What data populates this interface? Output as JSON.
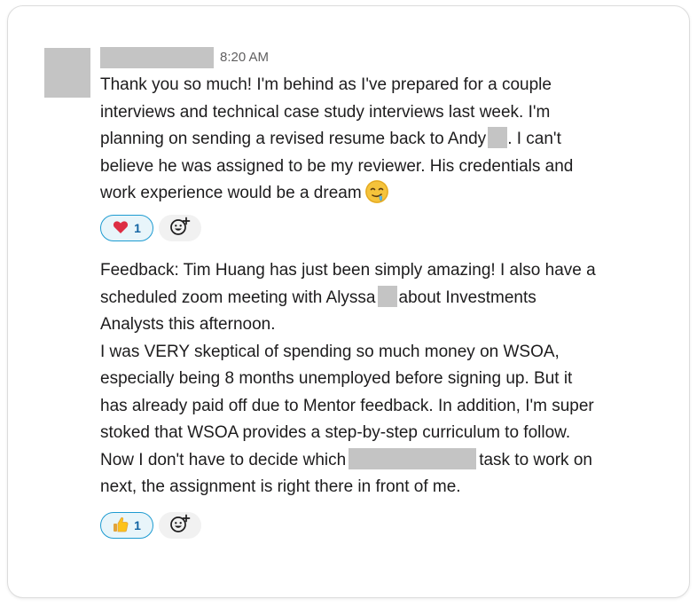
{
  "message": {
    "timestamp": "8:20 AM",
    "first": {
      "line1": "Thank you so much! I'm behind as I've prepared for a couple",
      "line2": "interviews and technical case study interviews last week. I'm",
      "line3_before": "planning on sending a revised resume back to Andy",
      "line3_after": ". I can't",
      "line4": "believe he was assigned to be my reviewer. His credentials and",
      "line5": "work experience would be a dream",
      "emoji": "drooling-face-icon"
    },
    "first_reaction": {
      "emoji": "heart-icon",
      "count": "1"
    },
    "second": {
      "line1": "Feedback: Tim Huang has just been simply amazing! I also have a",
      "line2_before": "scheduled zoom meeting with Alyssa",
      "line2_after": "about Investments",
      "line3": "Analysts this afternoon.",
      "line4": "I was VERY skeptical of spending so much money on WSOA,",
      "line5": "especially being 8 months unemployed before signing up. But it",
      "line6": "has already paid off due to Mentor feedback. In addition, I'm super",
      "line7": "stoked that WSOA provides a step-by-step curriculum to follow.",
      "line8_before": "Now I don't have to decide which",
      "line8_after": "task to work on",
      "line9": "next, the assignment is right there in front of me."
    },
    "second_reaction": {
      "emoji": "thumbs-up-icon",
      "count": "1"
    }
  },
  "colors": {
    "text": "#1d1c1d",
    "muted": "#616061",
    "redaction": "#c4c4c4",
    "reaction_border": "#1d9bd1",
    "reaction_bg": "#e8f5fa",
    "reaction_count": "#1264a3"
  }
}
